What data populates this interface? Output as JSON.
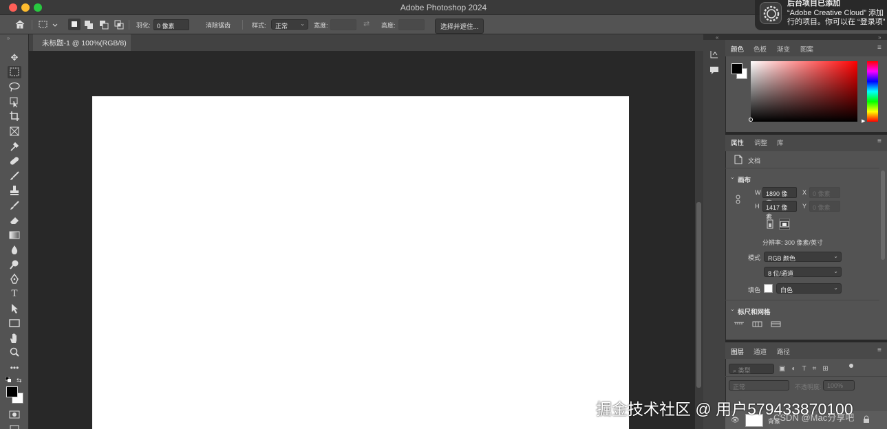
{
  "window": {
    "title": "Adobe Photoshop 2024"
  },
  "options_bar": {
    "feather_label": "羽化:",
    "feather_value": "0 像素",
    "antialias_label": "消除锯齿",
    "style_label": "样式:",
    "style_value": "正常",
    "width_label": "宽度:",
    "height_label": "高度:",
    "select_mask_button": "选择并遮住..."
  },
  "document_tab": {
    "label": "未标题-1 @ 100%(RGB/8)"
  },
  "color_panel": {
    "tabs": [
      "颜色",
      "色板",
      "渐变",
      "图案"
    ],
    "foreground": "#000000",
    "background": "#ffffff",
    "picker_hue": "#ff0000"
  },
  "properties_panel": {
    "tabs": [
      "属性",
      "调整",
      "库"
    ],
    "doc_label": "文档",
    "canvas_section": "画布",
    "w_label": "W",
    "w_value": "1890 像素",
    "h_label": "H",
    "h_value": "1417 像素",
    "x_label": "X",
    "x_placeholder": "0 像素",
    "y_label": "Y",
    "y_placeholder": "0 像素",
    "resolution": "分辨率: 300 像素/英寸",
    "mode_label": "模式",
    "mode_value": "RGB 颜色",
    "depth_value": "8 位/通道",
    "fill_label": "填色",
    "fill_value": "白色",
    "rulers_section": "标尺和网格"
  },
  "layers_panel": {
    "tabs": [
      "图层",
      "通道",
      "路径"
    ],
    "search_placeholder": "类型",
    "blend_mode": "正常",
    "opacity_label": "不透明度:",
    "opacity_value": "100%",
    "layer_name": "背景"
  },
  "notification": {
    "title": "后台项目已添加",
    "line1": "“Adobe Creative Cloud” 添加",
    "line2": "行的项目。你可以在 “登录项”"
  },
  "watermark": {
    "text": "掘金技术社区 @ 用户579433870100",
    "text2": "CSDN @Mac分享吧"
  }
}
